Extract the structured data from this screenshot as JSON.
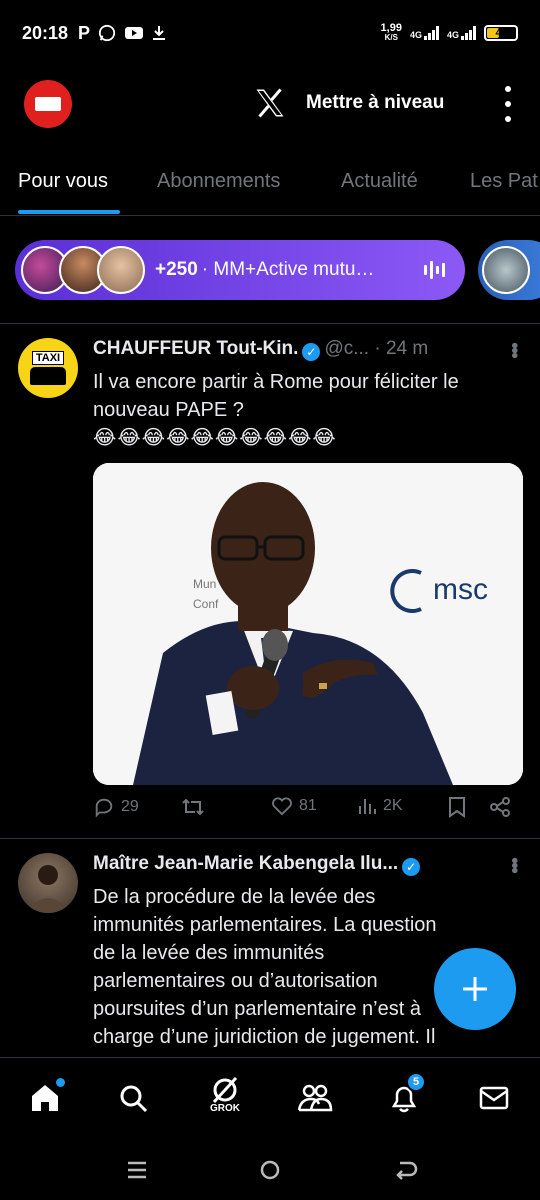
{
  "status_bar": {
    "time": "20:18",
    "net_speed": "1,99",
    "net_unit": "K/S",
    "sig1": "4G",
    "sig2": "4G",
    "battery": "40"
  },
  "header": {
    "upgrade_label": "Mettre à niveau"
  },
  "tabs": [
    {
      "label": "Pour vous"
    },
    {
      "label": "Abonnements"
    },
    {
      "label": "Actualité"
    },
    {
      "label": "Les Pat"
    }
  ],
  "spaces": {
    "count": "+250",
    "title": "· MM+Active mutu…"
  },
  "tweets": [
    {
      "avatar_text": "TAXI",
      "name": "CHAUFFEUR Tout-Kin.",
      "handle": "@c...",
      "time": "· 24 m",
      "line1": "Il va encore partir à Rome pour féliciter le",
      "line2": "nouveau PAPE ?",
      "emojis": "😂😂😂😂😂😂😂😂😂😂",
      "media_text_logo": "msc",
      "media_text_left1": "Mun",
      "media_text_left2": "Conf",
      "replies": "29",
      "likes": "81",
      "views": "2K"
    },
    {
      "name": "Maître Jean-Marie Kabengela Ilu...",
      "lines": [
        "De la procédure de la levée des",
        "immunités parlementaires. La question",
        "de la levée des immunités",
        "parlementaires ou d’autorisation",
        "poursuites d’un parlementaire n’est",
        "charge d’une juridiction de jugement. Il"
      ],
      "line5_tail": "à"
    }
  ],
  "bottom_nav": {
    "grok_label": "GROK",
    "notif_count": "5"
  },
  "colors": {
    "accent": "#1d9bf0",
    "spaces_gradient_start": "#5b2fd6",
    "spaces_gradient_end": "#8c59f5",
    "muted": "#71767b"
  }
}
